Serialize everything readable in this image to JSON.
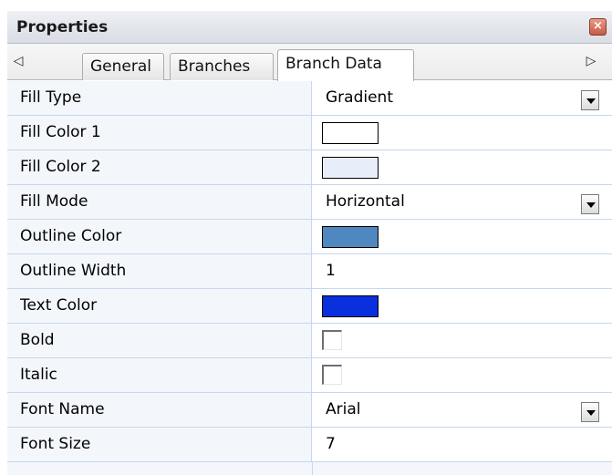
{
  "panel": {
    "title": "Properties",
    "close_glyph": "×"
  },
  "tabs": {
    "scroll_left": "◁",
    "scroll_right": "▷",
    "items": [
      {
        "label": "General",
        "active": false
      },
      {
        "label": "Branches",
        "active": false
      },
      {
        "label": "Branch Data",
        "active": true
      }
    ]
  },
  "properties": [
    {
      "name": "Fill Type",
      "kind": "dropdown",
      "value": "Gradient"
    },
    {
      "name": "Fill Color 1",
      "kind": "color",
      "color": "#ffffff"
    },
    {
      "name": "Fill Color 2",
      "kind": "color",
      "color": "#e7eef9"
    },
    {
      "name": "Fill Mode",
      "kind": "dropdown",
      "value": "Horizontal"
    },
    {
      "name": "Outline Color",
      "kind": "color",
      "color": "#4f87c0"
    },
    {
      "name": "Outline Width",
      "kind": "text",
      "value": "1"
    },
    {
      "name": "Text Color",
      "kind": "color",
      "color": "#0a2fdc"
    },
    {
      "name": "Bold",
      "kind": "checkbox",
      "checked": false
    },
    {
      "name": "Italic",
      "kind": "checkbox",
      "checked": false
    },
    {
      "name": "Font Name",
      "kind": "dropdown",
      "value": "Arial"
    },
    {
      "name": "Font Size",
      "kind": "text",
      "value": "7"
    }
  ]
}
